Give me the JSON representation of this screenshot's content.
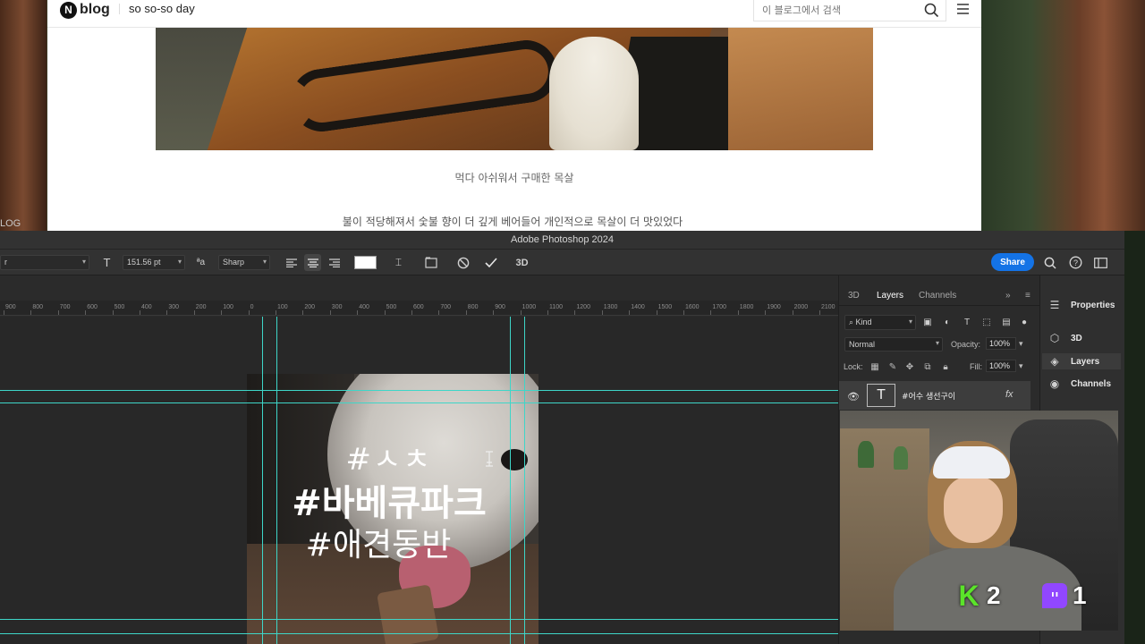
{
  "desktop": {
    "left_label": "LOG"
  },
  "browser": {
    "logo_n": "N",
    "logo_text": "blog",
    "blog_title": "so so-so day",
    "search_placeholder": "이 블로그에서 검색",
    "caption": "먹다 아쉬워서 구매한 목살",
    "body_text": "불이 적당해져서 숯불 향이 더 깊게 베어들어 개인적으로 목살이 더 맛있었다"
  },
  "photoshop": {
    "title": "Adobe Photoshop 2024",
    "options": {
      "font_family": "r",
      "font_size": "151.56 pt",
      "aa_label": "ªa",
      "antialias": "Sharp",
      "share_label": "Share",
      "three_d": "3D"
    },
    "ruler_labels": [
      "900",
      "800",
      "700",
      "600",
      "500",
      "400",
      "300",
      "200",
      "100",
      "0",
      "100",
      "200",
      "300",
      "400",
      "500",
      "600",
      "700",
      "800",
      "900",
      "1000",
      "1100",
      "1200",
      "1300",
      "1400",
      "1500",
      "1600",
      "1700",
      "1800",
      "1900",
      "2000",
      "2100"
    ],
    "document_text": {
      "line1": "#ㅅㅊ",
      "line2": "#바베큐파크",
      "line3": "#애견동반"
    },
    "panels": {
      "tabs": [
        "3D",
        "Layers",
        "Channels"
      ],
      "active_tab": "Layers",
      "filter_kind": "Kind",
      "blend_mode": "Normal",
      "opacity_label": "Opacity:",
      "opacity_value": "100%",
      "lock_label": "Lock:",
      "fill_label": "Fill:",
      "fill_value": "100%",
      "layer_name": "#어수 생선구이",
      "layer_fx": "fx"
    },
    "dock": {
      "items": [
        "Properties",
        "3D",
        "Layers",
        "Channels"
      ],
      "active": "Layers"
    }
  },
  "webcam": {
    "badge_k_icon": "K",
    "badge_k_count": "2",
    "badge_twitch_count": "1"
  },
  "colors": {
    "guide": "#3ed6c8",
    "share_button": "#1473e6",
    "twitch_purple": "#9147ff",
    "k_green": "#5be32a"
  }
}
